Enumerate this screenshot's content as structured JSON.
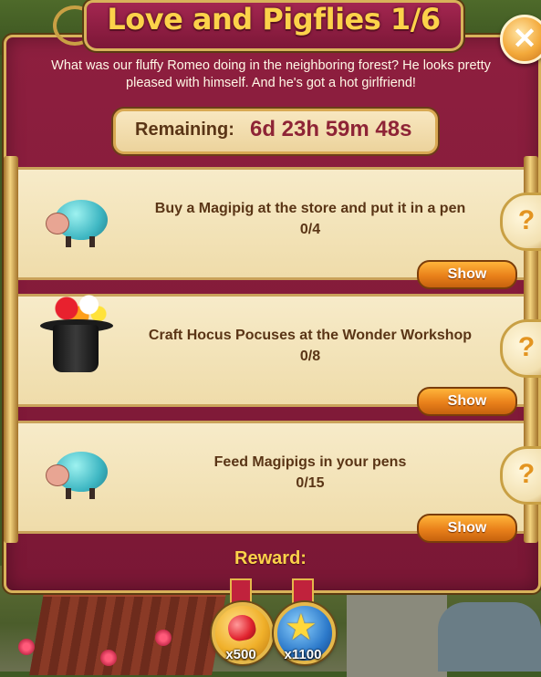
{
  "dialog": {
    "title": "Love and Pigflies 1/6",
    "description_line1": "What was our fluffy Romeo doing in the neighboring forest? He looks pretty",
    "description_line2": "pleased with himself. And he's got a hot girlfriend!",
    "remaining_label": "Remaining:",
    "remaining_value": "6d 23h 59m 48s"
  },
  "tasks": [
    {
      "text": "Buy a Magipig at the store and put it in a pen",
      "progress": "0/4",
      "show_label": "Show",
      "hint_label": "?",
      "icon": "magipig-icon"
    },
    {
      "text": "Craft Hocus Pocuses at the Wonder Workshop",
      "progress": "0/8",
      "show_label": "Show",
      "hint_label": "?",
      "icon": "magic-hat-icon"
    },
    {
      "text": "Feed Magipigs in your pens",
      "progress": "0/15",
      "show_label": "Show",
      "hint_label": "?",
      "icon": "magipig-bowtie-icon"
    }
  ],
  "reward": {
    "label": "Reward:",
    "items": [
      {
        "icon": "heart-icon",
        "count": "x500"
      },
      {
        "icon": "star-icon",
        "count": "x1100"
      }
    ]
  },
  "close_label": "✕",
  "colors": {
    "panel": "#8e1f3f",
    "gold": "#fcd24a",
    "parchment": "#f7ebc9",
    "button_orange": "#e9801a",
    "text_brown": "#5a3516",
    "timer_red": "#8e2436"
  }
}
